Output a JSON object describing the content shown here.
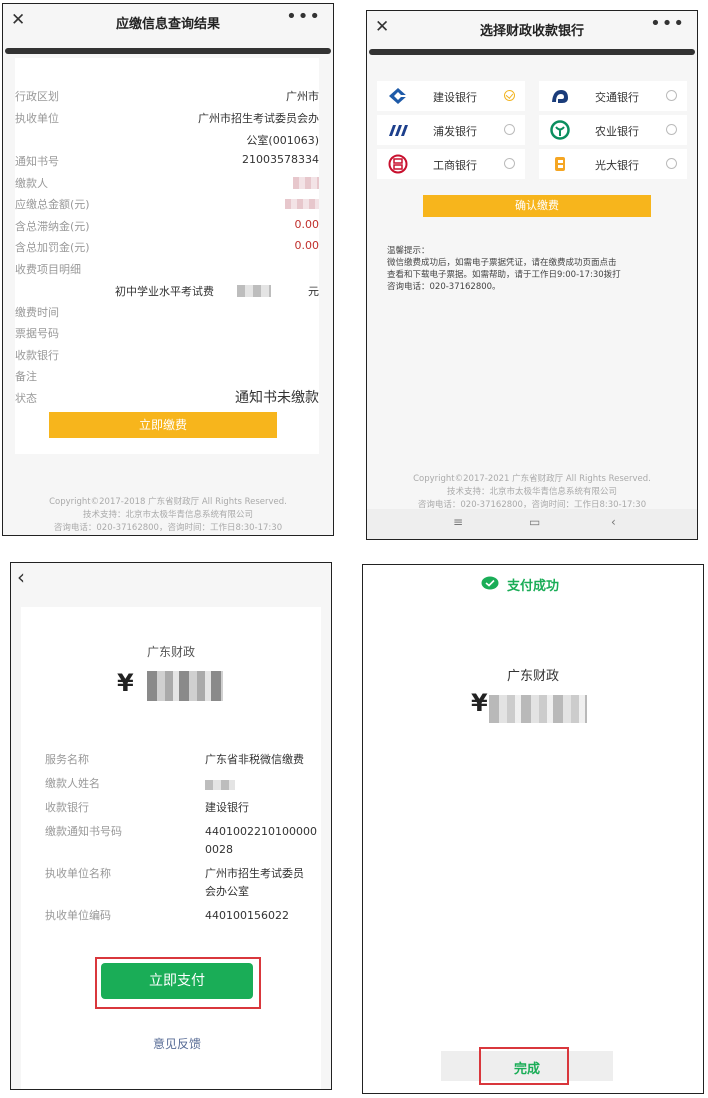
{
  "panel1": {
    "title": "应缴信息查询结果",
    "rows": [
      {
        "label": "行政区划",
        "value": "广州市"
      },
      {
        "label": "执收单位",
        "value": "广州市招生考试委员会办",
        "value2": "公室(001063)"
      },
      {
        "label": "通知书号",
        "value": "21003578334"
      },
      {
        "label": "缴款人",
        "value": ""
      },
      {
        "label": "应缴总金额(元)",
        "value": ""
      },
      {
        "label": "含总滞纳金(元)",
        "value": "0.00"
      },
      {
        "label": "含总加罚金(元)",
        "value": "0.00"
      },
      {
        "label": "收费项目明细",
        "value": ""
      },
      {
        "label": "缴费时间",
        "value": ""
      },
      {
        "label": "票据号码",
        "value": ""
      },
      {
        "label": "收款银行",
        "value": ""
      },
      {
        "label": "备注",
        "value": ""
      },
      {
        "label": "状态",
        "value": "通知书未缴款"
      }
    ],
    "item_detail": "初中学业水平考试费",
    "item_unit": "元",
    "pay_button": "立即缴费",
    "footer": [
      "Copyright©2017-2018 广东省财政厅 All Rights Reserved.",
      "技术支持：北京市太极华青信息系统有限公司",
      "咨询电话：020-37162800，咨询时间：工作日8:30-17:30"
    ]
  },
  "panel2": {
    "title": "选择财政收款银行",
    "banks": [
      {
        "name": "建设银行",
        "selected": true,
        "color": "#1e5aa8"
      },
      {
        "name": "交通银行",
        "selected": false,
        "color": "#1a3c7a"
      },
      {
        "name": "浦发银行",
        "selected": false,
        "color": "#1d3f8c"
      },
      {
        "name": "农业银行",
        "selected": false,
        "color": "#0b8e5e"
      },
      {
        "name": "工商银行",
        "selected": false,
        "color": "#c8102e"
      },
      {
        "name": "光大银行",
        "selected": false,
        "color": "#f5a623"
      }
    ],
    "confirm_button": "确认缴费",
    "tip_title": "温馨提示：",
    "tip_lines": [
      "微信缴费成功后，如需电子票据凭证，请在缴费成功页面点击",
      "查看和下载电子票据。如需帮助，请于工作日9:00-17:30拨打",
      "咨询电话：020-37162800。"
    ],
    "footer": [
      "Copyright©2017-2021 广东省财政厅 All Rights Reserved.",
      "技术支持：北京市太极华青信息系统有限公司",
      "咨询电话：020-37162800，咨询时间：工作日8:30-17:30"
    ]
  },
  "panel3": {
    "payee": "广东财政",
    "currency": "¥",
    "rows": [
      {
        "label": "服务名称",
        "value": "广东省非税微信缴费"
      },
      {
        "label": "缴款人姓名",
        "value": ""
      },
      {
        "label": "收款银行",
        "value": "建设银行"
      },
      {
        "label": "缴款通知书号码",
        "value": "4401002210100000",
        "value2": "0028"
      },
      {
        "label": "执收单位名称",
        "value": "广州市招生考试委员",
        "value2": "会办公室"
      },
      {
        "label": "执收单位编码",
        "value": "440100156022"
      }
    ],
    "pay_button": "立即支付",
    "feedback_link": "意见反馈"
  },
  "panel4": {
    "status": "支付成功",
    "payee": "广东财政",
    "currency": "¥",
    "done_button": "完成"
  }
}
